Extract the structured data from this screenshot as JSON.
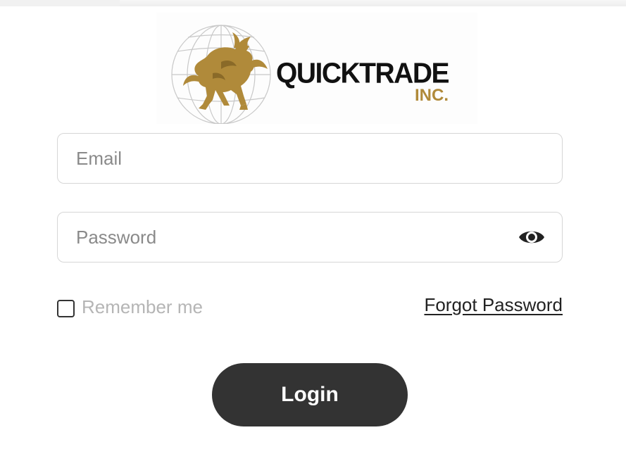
{
  "logo": {
    "name": "QUICKTRADE",
    "subtitle": "INC."
  },
  "form": {
    "email_placeholder": "Email",
    "password_placeholder": "Password",
    "remember_label": "Remember me",
    "forgot_label": "Forgot Password",
    "login_label": "Login"
  },
  "colors": {
    "gold": "#b08a3a",
    "button": "#333333",
    "border": "#d6d6d6"
  },
  "icons": {
    "password_toggle": "eye-icon",
    "logo_mark": "bull-globe-icon"
  }
}
